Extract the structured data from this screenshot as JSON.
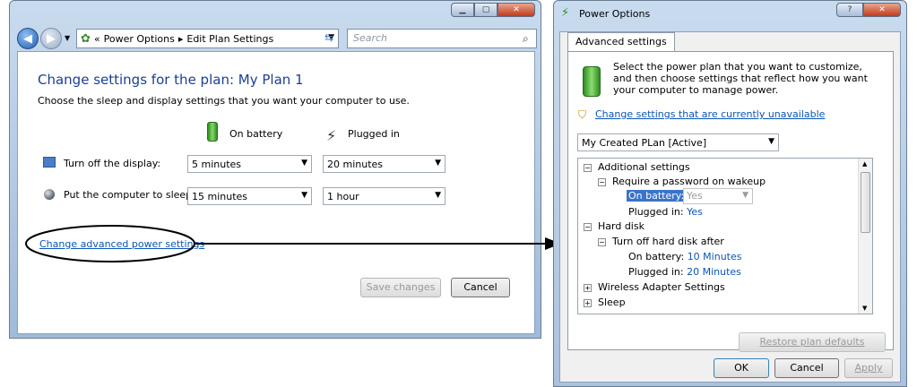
{
  "left_window": {
    "address": {
      "prefix": "«",
      "crumb1": "Power Options",
      "sep": "▸",
      "crumb2": "Edit Plan Settings"
    },
    "search_placeholder": "Search",
    "heading": "Change settings for the plan: My Plan 1",
    "subheading": "Choose the sleep and display settings that you want your computer to use.",
    "col_battery": "On battery",
    "col_plugged": "Plugged in",
    "rows": [
      {
        "label": "Turn off the display:",
        "battery": "5 minutes",
        "plugged": "20 minutes"
      },
      {
        "label": "Put the computer to sleep:",
        "battery": "15 minutes",
        "plugged": "1 hour"
      }
    ],
    "advanced_link": "Change advanced power settings",
    "save_button": "Save changes",
    "cancel_button": "Cancel"
  },
  "right_window": {
    "title": "Power Options",
    "help_btn": "?",
    "tab": "Advanced settings",
    "description": "Select the power plan that you want to customize, and then choose settings that reflect how you want your computer to manage power.",
    "change_link": "Change settings that are currently unavailable",
    "plan_select": "My Created PLan [Active]",
    "tree": {
      "additional": "Additional settings",
      "require_pw": "Require a password on wakeup",
      "on_battery_label": "On battery:",
      "on_battery_value": "Yes",
      "plugged_label": "Plugged in:",
      "plugged_value": "Yes",
      "hard_disk": "Hard disk",
      "turn_off_disk": "Turn off hard disk after",
      "disk_battery_label": "On battery:",
      "disk_battery_value": "10 Minutes",
      "disk_plugged_label": "Plugged in:",
      "disk_plugged_value": "20 Minutes",
      "wireless": "Wireless Adapter Settings",
      "sleep": "Sleep"
    },
    "restore_button": "Restore plan defaults",
    "ok_button": "OK",
    "cancel_button": "Cancel",
    "apply_button": "Apply"
  },
  "icons": {
    "back": "back-arrow-icon",
    "forward": "forward-arrow-icon",
    "battery": "battery-icon",
    "plug": "plug-icon",
    "shield": "uac-shield-icon"
  },
  "colors": {
    "link": "#0a55b8",
    "close_red": "#c23a1c",
    "battery_green": "#3fae2a"
  }
}
